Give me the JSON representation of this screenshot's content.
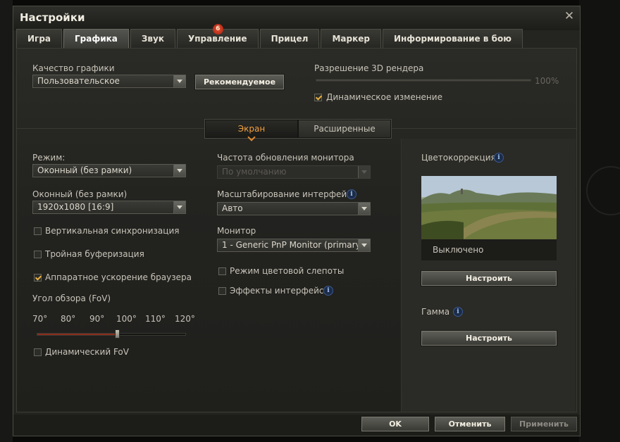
{
  "window": {
    "title": "Настройки"
  },
  "tabs": [
    {
      "label": "Игра"
    },
    {
      "label": "Графика"
    },
    {
      "label": "Звук"
    },
    {
      "label": "Управление",
      "badge": "6"
    },
    {
      "label": "Прицел"
    },
    {
      "label": "Маркер"
    },
    {
      "label": "Информирование в бою"
    }
  ],
  "quality": {
    "label": "Качество графики",
    "value": "Пользовательское",
    "recommended_button": "Рекомендуемое"
  },
  "render": {
    "label": "Разрешение 3D рендера",
    "value_text": "100%",
    "value": 1.0,
    "dynamic_label": "Динамическое изменение",
    "dynamic_checked": true
  },
  "subtabs": [
    {
      "label": "Экран"
    },
    {
      "label": "Расширенные"
    }
  ],
  "left": {
    "mode_label": "Режим:",
    "mode_value": "Оконный (без рамки)",
    "resolution_label": "Оконный (без рамки)",
    "resolution_value": "1920x1080 [16:9]",
    "vsync_label": "Вертикальная синхронизация",
    "vsync_checked": false,
    "triple_label": "Тройная буферизация",
    "triple_checked": false,
    "browser_accel_label": "Аппаратное ускорение браузера",
    "browser_accel_checked": true,
    "fov_label": "Угол обзора (FoV)",
    "fov_ticks": [
      "70°",
      "80°",
      "90°",
      "100°",
      "110°",
      "120°"
    ],
    "fov_value": 97,
    "fov_min": 70,
    "fov_max": 120,
    "dynamic_fov_label": "Динамический FoV",
    "dynamic_fov_checked": false
  },
  "middle": {
    "refresh_label": "Частота обновления монитора",
    "refresh_value": "По умолчанию",
    "scale_label": "Масштабирование интерфейса",
    "scale_value": "Авто",
    "monitor_label": "Монитор",
    "monitor_value": "1 - Generic PnP Monitor (primary)",
    "colorblind_label": "Режим цветовой слепоты",
    "colorblind_checked": false,
    "effects_label": "Эффекты интерфейса",
    "effects_checked": false
  },
  "right": {
    "color_label": "Цветокоррекция",
    "color_value": "Выключено",
    "color_button": "Настроить",
    "gamma_label": "Гамма",
    "gamma_button": "Настроить"
  },
  "footer": {
    "ok": "OK",
    "cancel": "Отменить",
    "apply": "Применить"
  },
  "colors": {
    "accent": "#f0a040",
    "check": "#e6b040",
    "badge": "#d04020",
    "info": "#3a5a90"
  }
}
